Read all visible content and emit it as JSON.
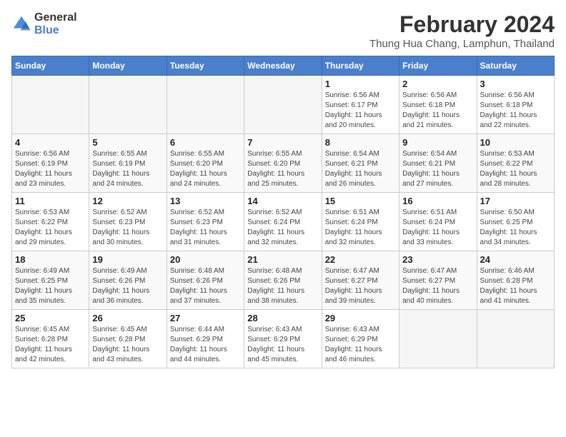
{
  "logo": {
    "line1": "General",
    "line2": "Blue"
  },
  "title": "February 2024",
  "subtitle": "Thung Hua Chang, Lamphun, Thailand",
  "days_of_week": [
    "Sunday",
    "Monday",
    "Tuesday",
    "Wednesday",
    "Thursday",
    "Friday",
    "Saturday"
  ],
  "weeks": [
    [
      {
        "day": "",
        "info": ""
      },
      {
        "day": "",
        "info": ""
      },
      {
        "day": "",
        "info": ""
      },
      {
        "day": "",
        "info": ""
      },
      {
        "day": "1",
        "info": "Sunrise: 6:56 AM\nSunset: 6:17 PM\nDaylight: 11 hours\nand 20 minutes."
      },
      {
        "day": "2",
        "info": "Sunrise: 6:56 AM\nSunset: 6:18 PM\nDaylight: 11 hours\nand 21 minutes."
      },
      {
        "day": "3",
        "info": "Sunrise: 6:56 AM\nSunset: 6:18 PM\nDaylight: 11 hours\nand 22 minutes."
      }
    ],
    [
      {
        "day": "4",
        "info": "Sunrise: 6:56 AM\nSunset: 6:19 PM\nDaylight: 11 hours\nand 23 minutes."
      },
      {
        "day": "5",
        "info": "Sunrise: 6:55 AM\nSunset: 6:19 PM\nDaylight: 11 hours\nand 24 minutes."
      },
      {
        "day": "6",
        "info": "Sunrise: 6:55 AM\nSunset: 6:20 PM\nDaylight: 11 hours\nand 24 minutes."
      },
      {
        "day": "7",
        "info": "Sunrise: 6:55 AM\nSunset: 6:20 PM\nDaylight: 11 hours\nand 25 minutes."
      },
      {
        "day": "8",
        "info": "Sunrise: 6:54 AM\nSunset: 6:21 PM\nDaylight: 11 hours\nand 26 minutes."
      },
      {
        "day": "9",
        "info": "Sunrise: 6:54 AM\nSunset: 6:21 PM\nDaylight: 11 hours\nand 27 minutes."
      },
      {
        "day": "10",
        "info": "Sunrise: 6:53 AM\nSunset: 6:22 PM\nDaylight: 11 hours\nand 28 minutes."
      }
    ],
    [
      {
        "day": "11",
        "info": "Sunrise: 6:53 AM\nSunset: 6:22 PM\nDaylight: 11 hours\nand 29 minutes."
      },
      {
        "day": "12",
        "info": "Sunrise: 6:52 AM\nSunset: 6:23 PM\nDaylight: 11 hours\nand 30 minutes."
      },
      {
        "day": "13",
        "info": "Sunrise: 6:52 AM\nSunset: 6:23 PM\nDaylight: 11 hours\nand 31 minutes."
      },
      {
        "day": "14",
        "info": "Sunrise: 6:52 AM\nSunset: 6:24 PM\nDaylight: 11 hours\nand 32 minutes."
      },
      {
        "day": "15",
        "info": "Sunrise: 6:51 AM\nSunset: 6:24 PM\nDaylight: 11 hours\nand 32 minutes."
      },
      {
        "day": "16",
        "info": "Sunrise: 6:51 AM\nSunset: 6:24 PM\nDaylight: 11 hours\nand 33 minutes."
      },
      {
        "day": "17",
        "info": "Sunrise: 6:50 AM\nSunset: 6:25 PM\nDaylight: 11 hours\nand 34 minutes."
      }
    ],
    [
      {
        "day": "18",
        "info": "Sunrise: 6:49 AM\nSunset: 6:25 PM\nDaylight: 11 hours\nand 35 minutes."
      },
      {
        "day": "19",
        "info": "Sunrise: 6:49 AM\nSunset: 6:26 PM\nDaylight: 11 hours\nand 36 minutes."
      },
      {
        "day": "20",
        "info": "Sunrise: 6:48 AM\nSunset: 6:26 PM\nDaylight: 11 hours\nand 37 minutes."
      },
      {
        "day": "21",
        "info": "Sunrise: 6:48 AM\nSunset: 6:26 PM\nDaylight: 11 hours\nand 38 minutes."
      },
      {
        "day": "22",
        "info": "Sunrise: 6:47 AM\nSunset: 6:27 PM\nDaylight: 11 hours\nand 39 minutes."
      },
      {
        "day": "23",
        "info": "Sunrise: 6:47 AM\nSunset: 6:27 PM\nDaylight: 11 hours\nand 40 minutes."
      },
      {
        "day": "24",
        "info": "Sunrise: 6:46 AM\nSunset: 6:28 PM\nDaylight: 11 hours\nand 41 minutes."
      }
    ],
    [
      {
        "day": "25",
        "info": "Sunrise: 6:45 AM\nSunset: 6:28 PM\nDaylight: 11 hours\nand 42 minutes."
      },
      {
        "day": "26",
        "info": "Sunrise: 6:45 AM\nSunset: 6:28 PM\nDaylight: 11 hours\nand 43 minutes."
      },
      {
        "day": "27",
        "info": "Sunrise: 6:44 AM\nSunset: 6:29 PM\nDaylight: 11 hours\nand 44 minutes."
      },
      {
        "day": "28",
        "info": "Sunrise: 6:43 AM\nSunset: 6:29 PM\nDaylight: 11 hours\nand 45 minutes."
      },
      {
        "day": "29",
        "info": "Sunrise: 6:43 AM\nSunset: 6:29 PM\nDaylight: 11 hours\nand 46 minutes."
      },
      {
        "day": "",
        "info": ""
      },
      {
        "day": "",
        "info": ""
      }
    ]
  ]
}
